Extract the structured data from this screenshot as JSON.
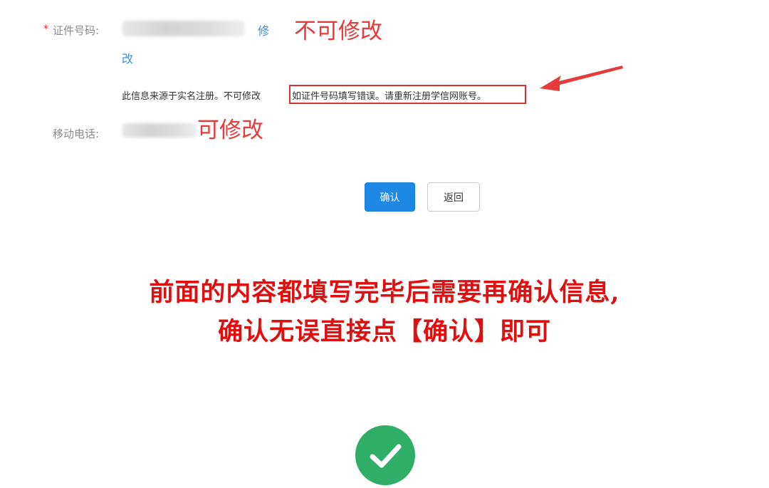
{
  "form": {
    "id_number": {
      "required_mark": "*",
      "label": "证件号码:",
      "edit_link_line1": "修",
      "edit_link_line2": "改",
      "annotation": "不可修改",
      "info_prefix": "此信息来源于实名注册。不可修改",
      "info_highlight": "如证件号码填写错误。请重新注册学信网账号。"
    },
    "mobile": {
      "label": "移动电话:",
      "annotation": "可修改"
    }
  },
  "buttons": {
    "confirm_label": "确认",
    "back_label": "返回"
  },
  "caption": {
    "line1": "前面的内容都填写完毕后需要再确认信息,",
    "line2": "确认无误直接点【确认】即可"
  },
  "icons": {
    "success": "check-circle-icon",
    "arrow": "red-arrow-icon"
  },
  "colors": {
    "annotation_red": "#e73b3b",
    "caption_red": "#e00f0f",
    "primary_blue": "#1e88e5",
    "link_blue": "#3a8ee6",
    "success_green": "#2fae67"
  }
}
